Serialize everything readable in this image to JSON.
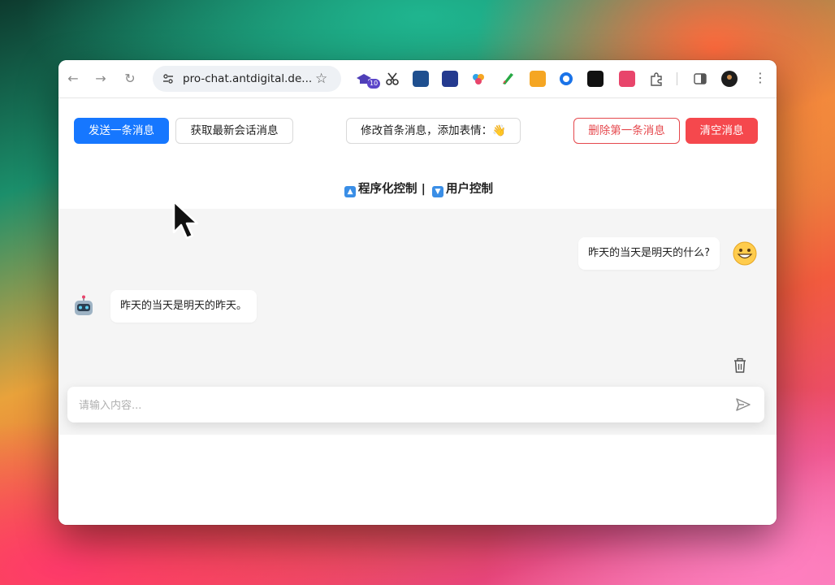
{
  "browser": {
    "url": "pro-chat.antdigital.de...",
    "extension_badge_count": "10"
  },
  "toolbar": {
    "send_label": "发送一条消息",
    "fetch_label": "获取最新会话消息",
    "edit_first_label": "修改首条消息，添加表情：👋",
    "delete_first_label": "删除第一条消息",
    "clear_label": "清空消息"
  },
  "subtitle": {
    "part1": "程序化控制",
    "separator": "|",
    "part2": "用户控制"
  },
  "messages": [
    {
      "role": "user",
      "text": "昨天的当天是明天的什么?"
    },
    {
      "role": "assistant",
      "text": "昨天的当天是明天的昨天。"
    }
  ],
  "input": {
    "placeholder": "请输入内容..."
  },
  "colors": {
    "primary": "#1677ff",
    "danger": "#f5484d",
    "chat_bg": "#f5f5f5"
  }
}
